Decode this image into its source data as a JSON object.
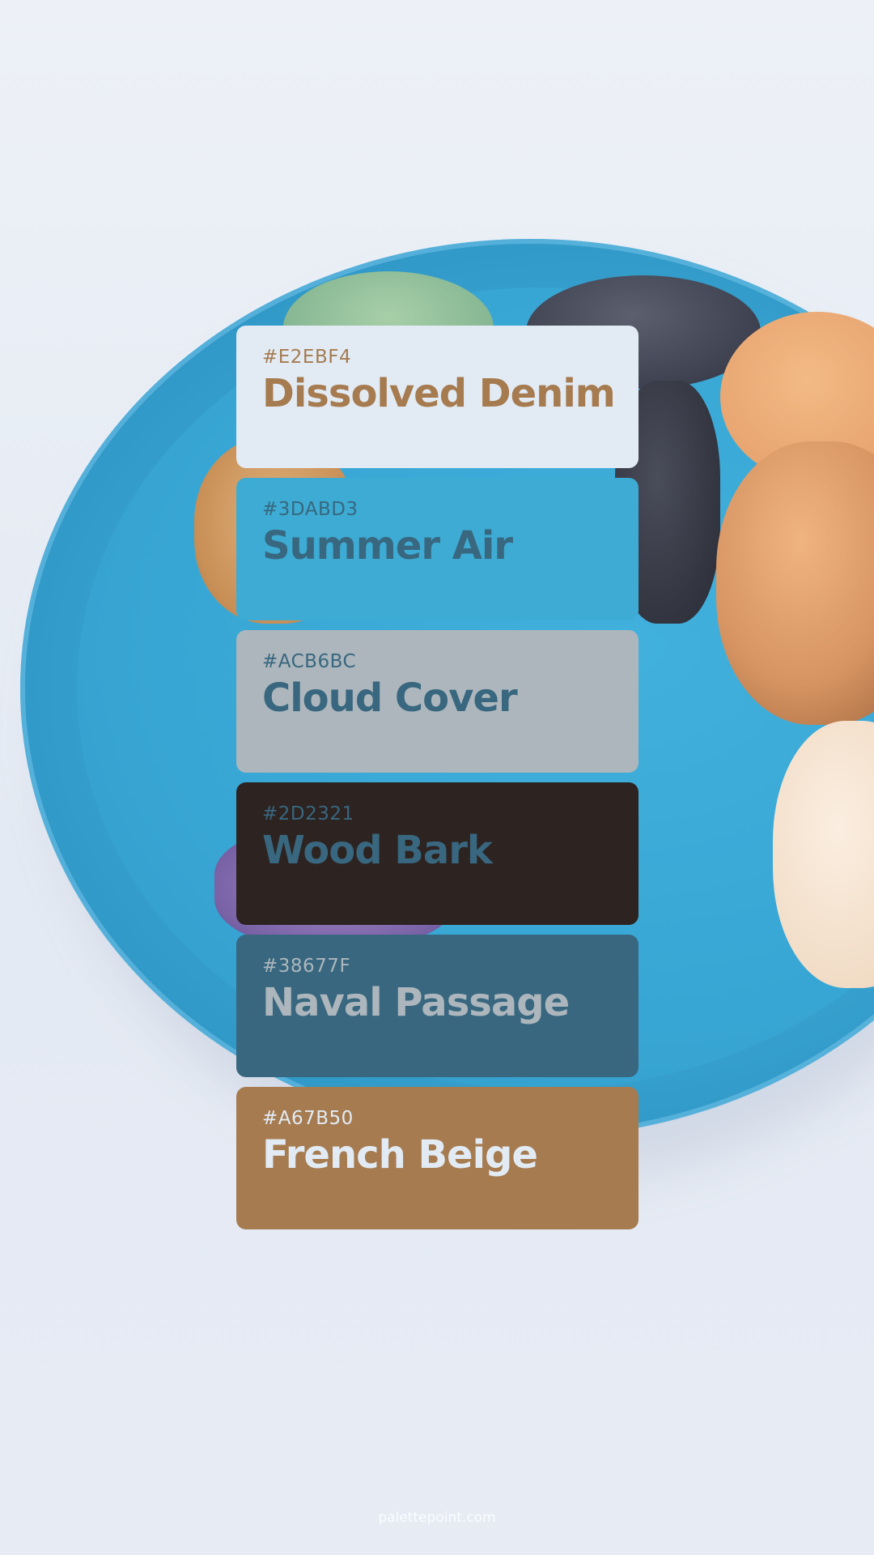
{
  "palette": {
    "swatches": [
      {
        "hex_label": "#E2EBF4",
        "name": "Dissolved Denim",
        "bg": "#E2EBF4",
        "text": "#A67B50"
      },
      {
        "hex_label": "#3DABD3",
        "name": "Summer Air",
        "bg": "#3DABD3",
        "text": "#38677F"
      },
      {
        "hex_label": "#ACB6BC",
        "name": "Cloud Cover",
        "bg": "#ACB6BC",
        "text": "#38677F"
      },
      {
        "hex_label": "#2D2321",
        "name": "Wood Bark",
        "bg": "#2D2321",
        "text": "#38677F"
      },
      {
        "hex_label": "#38677F",
        "name": "Naval Passage",
        "bg": "#38677F",
        "text": "#ACB6BC"
      },
      {
        "hex_label": "#A67B50",
        "name": "French Beige",
        "bg": "#A67B50",
        "text": "#E2EBF4"
      }
    ]
  },
  "footer": {
    "watermark": "palettepoint.com"
  }
}
